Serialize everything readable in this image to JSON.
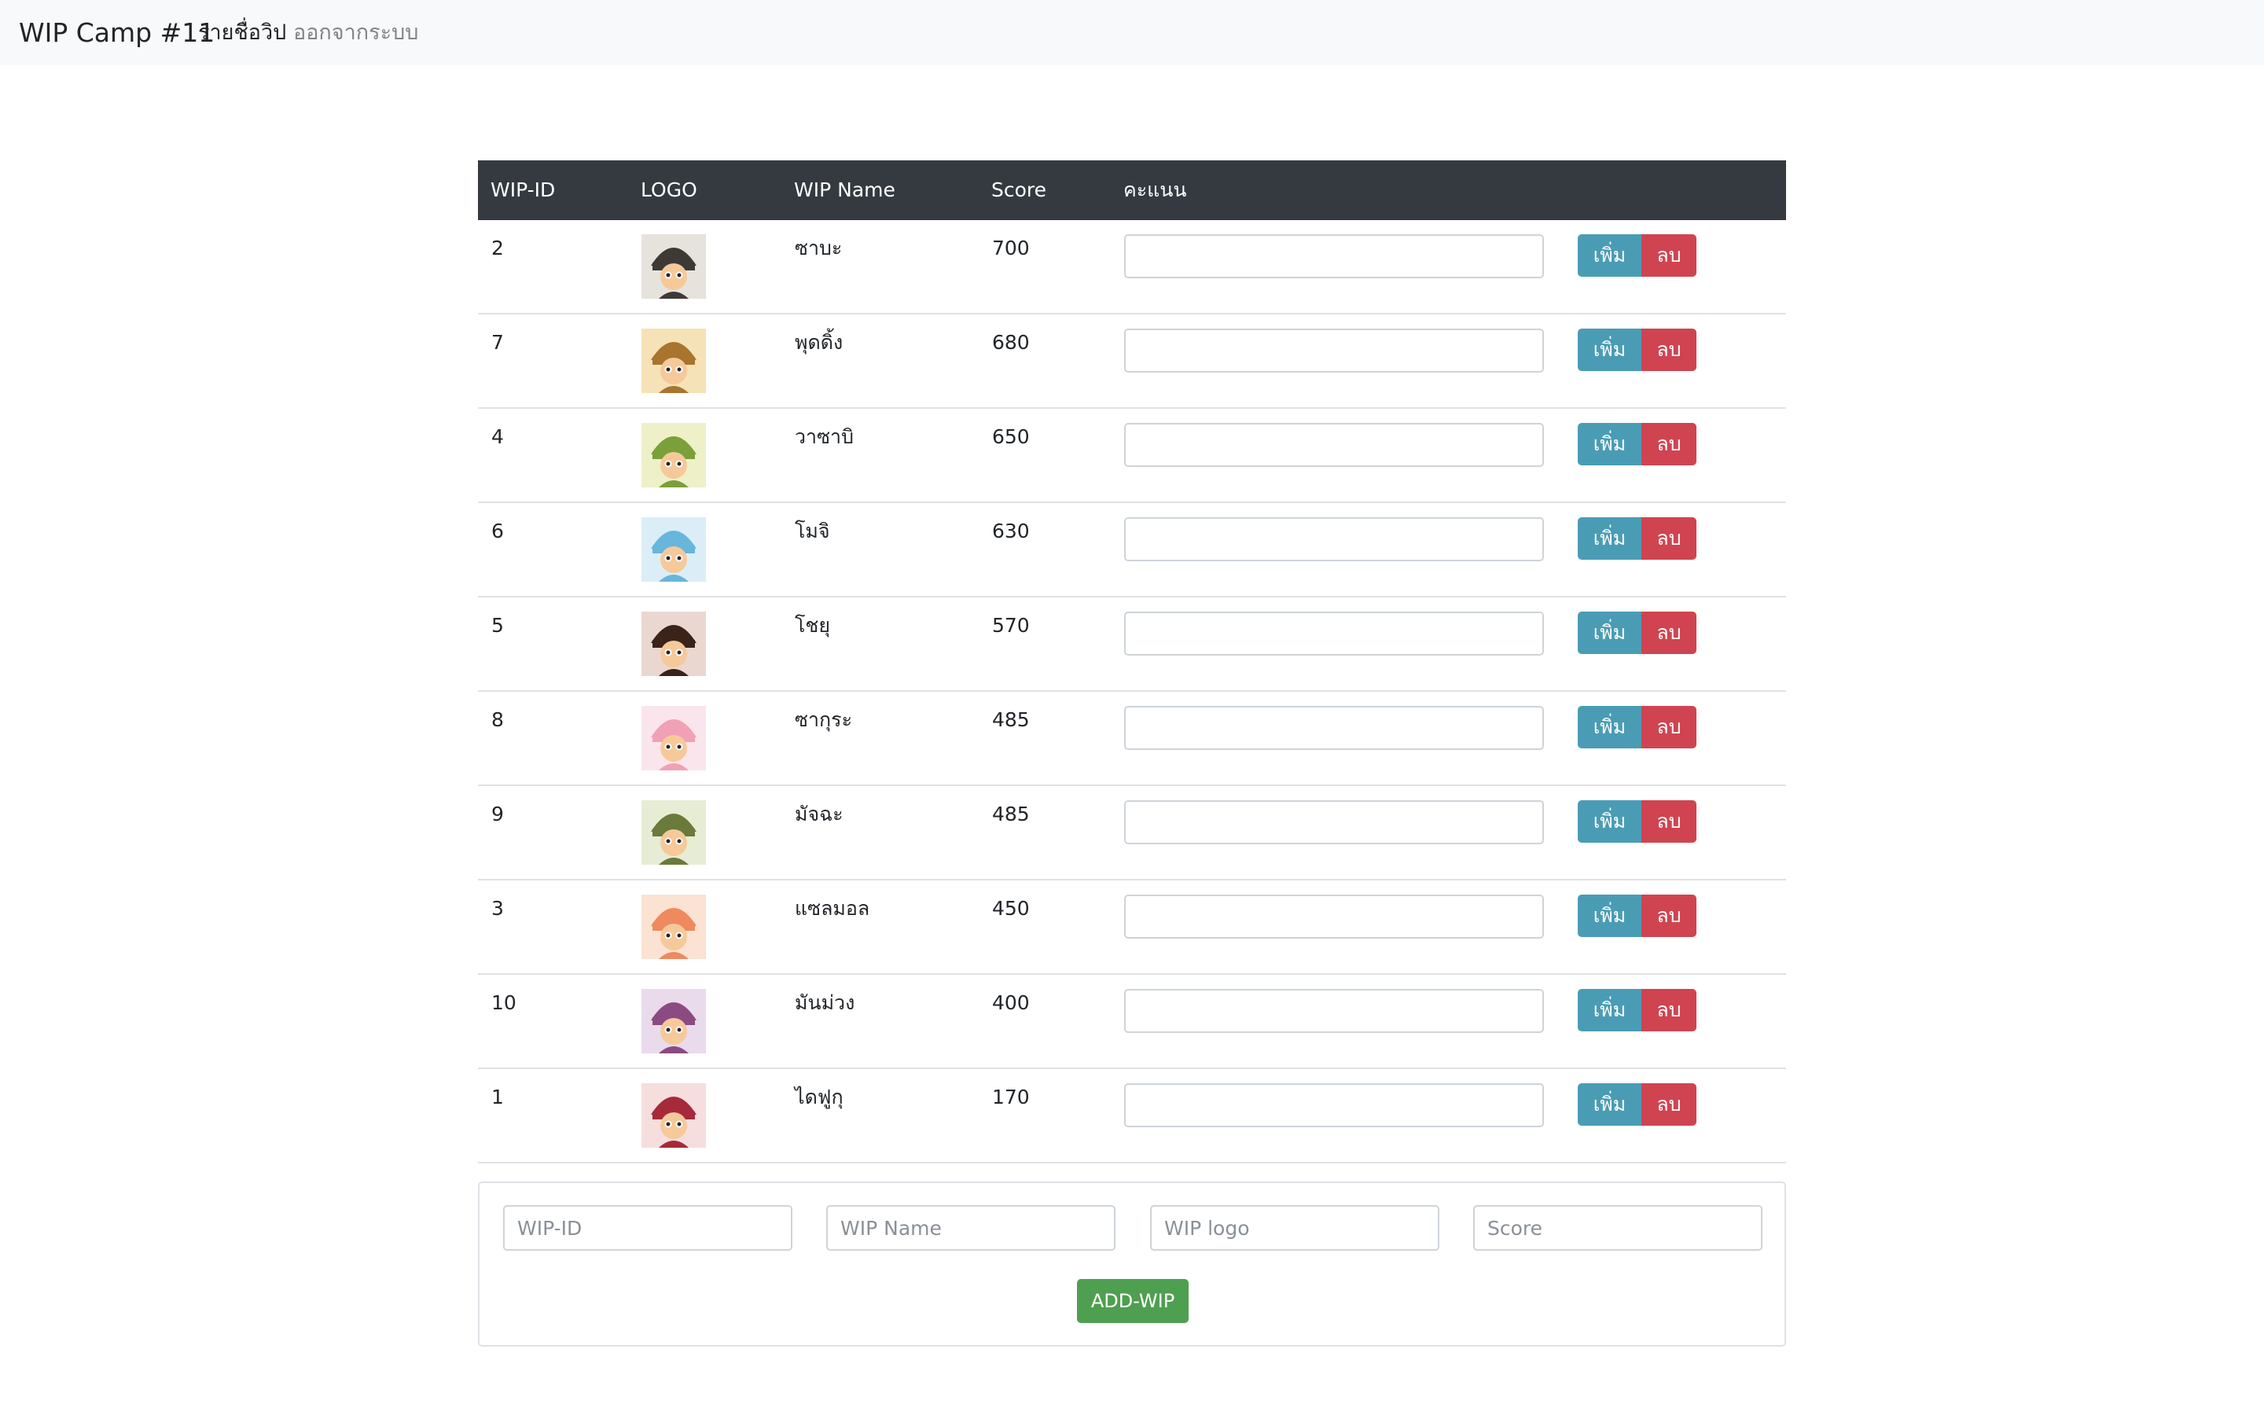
{
  "navbar": {
    "brand": "WIP Camp #11",
    "links": [
      {
        "label": "รายชื่อวิป"
      },
      {
        "label": "ออกจากระบบ"
      }
    ]
  },
  "table": {
    "headers": [
      "WIP-ID",
      "LOGO",
      "WIP Name",
      "Score",
      "คะแนน"
    ],
    "rows": [
      {
        "id": "2",
        "name": "ซาบะ",
        "score": "700",
        "logo_color": "#3d3a36",
        "bg": "#e6e3dc"
      },
      {
        "id": "7",
        "name": "พุดดิ้ง",
        "score": "680",
        "logo_color": "#a8742e",
        "bg": "#f5e2b6"
      },
      {
        "id": "4",
        "name": "วาซาบิ",
        "score": "650",
        "logo_color": "#7aa03a",
        "bg": "#eef0c8"
      },
      {
        "id": "6",
        "name": "โมจิ",
        "score": "630",
        "logo_color": "#68b6dc",
        "bg": "#dbeef7"
      },
      {
        "id": "5",
        "name": "โชยุ",
        "score": "570",
        "logo_color": "#3a2419",
        "bg": "#ead8d0"
      },
      {
        "id": "8",
        "name": "ซากุระ",
        "score": "485",
        "logo_color": "#f1a1b6",
        "bg": "#fbe5ec"
      },
      {
        "id": "9",
        "name": "มัจฉะ",
        "score": "485",
        "logo_color": "#6a7a3a",
        "bg": "#e7ecd4"
      },
      {
        "id": "3",
        "name": "แซลมอล",
        "score": "450",
        "logo_color": "#ee8a5e",
        "bg": "#fbe2d2"
      },
      {
        "id": "10",
        "name": "มันม่วง",
        "score": "400",
        "logo_color": "#8c4a82",
        "bg": "#e9dbeb"
      },
      {
        "id": "1",
        "name": "ไดฟูกุ",
        "score": "170",
        "logo_color": "#a52a3a",
        "bg": "#f6dede"
      }
    ],
    "add_label": "เพิ่ม",
    "delete_label": "ลบ"
  },
  "form": {
    "placeholders": [
      "WIP-ID",
      "WIP Name",
      "WIP logo",
      "Score"
    ],
    "submit_label": "ADD-WIP"
  },
  "colors": {
    "navbar_bg": "#f8f9fa",
    "table_header_bg": "#343a40",
    "add_button": "#4a9cb5",
    "delete_button": "#cf4450",
    "submit_button": "#4f9f50"
  }
}
